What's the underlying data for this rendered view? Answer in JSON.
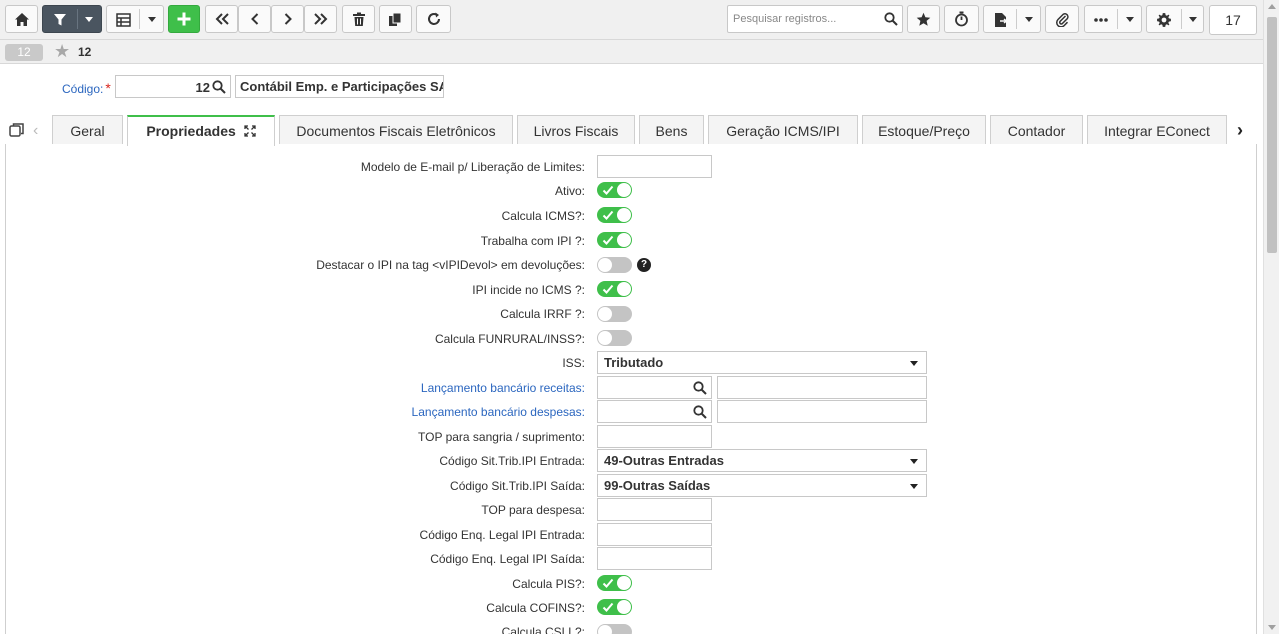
{
  "toolbar": {
    "search_placeholder": "Pesquisar registros...",
    "page_number": "17"
  },
  "record": {
    "badge": "12",
    "number": "12"
  },
  "header": {
    "code_label": "Código:",
    "required_mark": "*",
    "code_value": "12",
    "name_value": "Contábil Emp. e Participações SA"
  },
  "tabs": [
    {
      "label": "Geral"
    },
    {
      "label": "Propriedades"
    },
    {
      "label": "Documentos Fiscais Eletrônicos"
    },
    {
      "label": "Livros Fiscais"
    },
    {
      "label": "Bens"
    },
    {
      "label": "Geração ICMS/IPI"
    },
    {
      "label": "Estoque/Preço"
    },
    {
      "label": "Contador"
    },
    {
      "label": "Integrar EConect"
    }
  ],
  "form": {
    "modelo_email": {
      "label": "Modelo de E-mail p/ Liberação de Limites:",
      "value": ""
    },
    "ativo": {
      "label": "Ativo:",
      "on": true
    },
    "calcula_icms": {
      "label": "Calcula ICMS?:",
      "on": true
    },
    "trabalha_ipi": {
      "label": "Trabalha com IPI ?:",
      "on": true
    },
    "destacar_ipi": {
      "label": "Destacar o IPI na tag <vIPIDevol> em devoluções:",
      "on": false,
      "help": "?"
    },
    "ipi_incide_icms": {
      "label": "IPI incide no ICMS ?:",
      "on": true
    },
    "calcula_irrf": {
      "label": "Calcula IRRF ?:",
      "on": false
    },
    "calcula_funrural": {
      "label": "Calcula FUNRURAL/INSS?:",
      "on": false
    },
    "iss": {
      "label": "ISS:",
      "value": "Tributado"
    },
    "lanc_receitas": {
      "label": "Lançamento bancário receitas:",
      "value": "",
      "desc": ""
    },
    "lanc_despesas": {
      "label": "Lançamento bancário despesas:",
      "value": "",
      "desc": ""
    },
    "top_sangria": {
      "label": "TOP para sangria / suprimento:",
      "value": ""
    },
    "cst_ipi_entrada": {
      "label": "Código Sit.Trib.IPI Entrada:",
      "value": "49-Outras Entradas"
    },
    "cst_ipi_saida": {
      "label": "Código Sit.Trib.IPI Saída:",
      "value": "99-Outras Saídas"
    },
    "top_despesa": {
      "label": "TOP para despesa:",
      "value": ""
    },
    "enq_ipi_entrada": {
      "label": "Código Enq. Legal IPI Entrada:",
      "value": ""
    },
    "enq_ipi_saida": {
      "label": "Código Enq. Legal IPI Saída:",
      "value": ""
    },
    "calcula_pis": {
      "label": "Calcula PIS?:",
      "on": true
    },
    "calcula_cofins": {
      "label": "Calcula COFINS?:",
      "on": true
    },
    "calcula_csll": {
      "label": "Calcula CSLL?:",
      "on": false
    }
  },
  "colors": {
    "accent_green": "#3fbf4a",
    "link_blue": "#2b66bf",
    "required_red": "#d9251d"
  }
}
